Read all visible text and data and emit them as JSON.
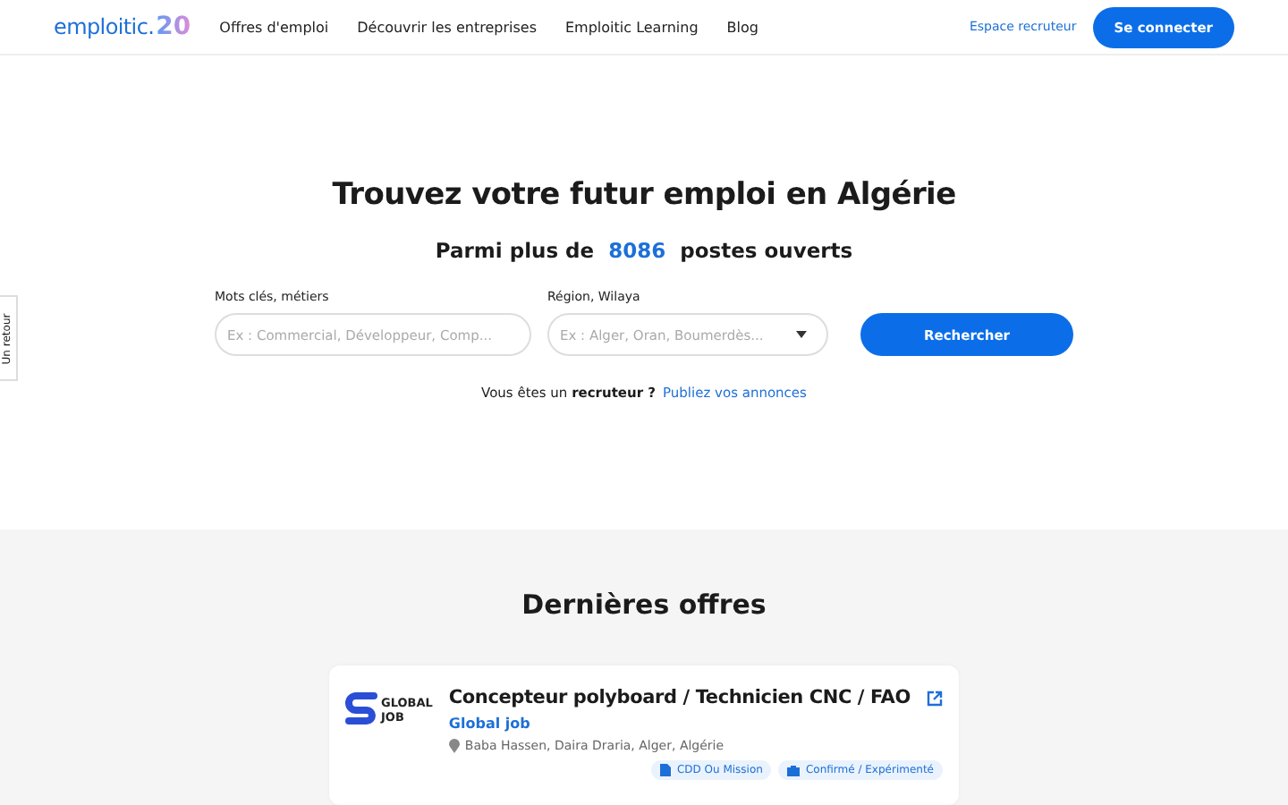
{
  "header": {
    "logo": {
      "text": "emploitic.",
      "badge": "20"
    },
    "nav": [
      "Offres d'emploi",
      "Découvrir les entreprises",
      "Emploitic Learning",
      "Blog"
    ],
    "recruiter_link": "Espace recruteur",
    "login_button": "Se connecter"
  },
  "feedback_tab": "Un retour",
  "hero": {
    "title": "Trouvez votre futur emploi en Algérie",
    "subtitle_before": "Parmi plus de",
    "count": "8086",
    "subtitle_after": "postes ouverts",
    "keywords": {
      "label": "Mots clés, métiers",
      "placeholder": "Ex : Commercial, Développeur, Comp..."
    },
    "region": {
      "label": "Région, Wilaya",
      "placeholder": "Ex : Alger, Oran, Boumerdès..."
    },
    "search_button": "Rechercher",
    "recruiter_prompt": "Vous êtes un **recruteur ?**",
    "recruiter_link": "Publiez vos annonces"
  },
  "latest": {
    "title": "Dernières offres",
    "offers": [
      {
        "logo_lines": [
          "GLOBAL",
          "JOB"
        ],
        "title": "Concepteur polyboard / Technicien CNC / FAO",
        "company": "Global job",
        "location": "Baba Hassen, Daira Draria, Alger, Algérie",
        "tags": [
          {
            "kind": "contract",
            "label": "CDD Ou Mission"
          },
          {
            "kind": "experience",
            "label": "Confirmé / Expérimenté"
          }
        ]
      }
    ]
  }
}
